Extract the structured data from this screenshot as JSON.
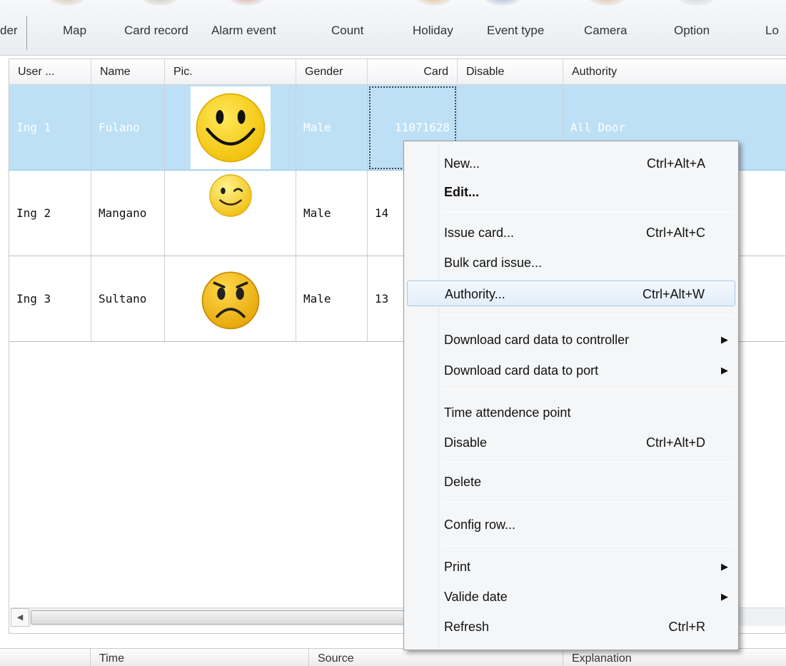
{
  "toolbar": {
    "items": [
      "der",
      "Map",
      "Card record",
      "Alarm event",
      "Count",
      "Holiday",
      "Event type",
      "Camera",
      "Option",
      "Lo"
    ]
  },
  "grid": {
    "columns": [
      "User ...",
      "Name",
      "Pic.",
      "Gender",
      "Card",
      "Disable",
      "Authority"
    ],
    "rows": [
      {
        "user": "Ing 1",
        "name": "Fulano",
        "pic": "smiley-happy",
        "gender": "Male",
        "card": "11071628",
        "disable": "",
        "authority": "All Door"
      },
      {
        "user": "Ing 2",
        "name": "Mangano",
        "pic": "smiley-wink",
        "gender": "Male",
        "card": "14",
        "disable": "",
        "authority": ""
      },
      {
        "user": "Ing 3",
        "name": "Sultano",
        "pic": "smiley-sad",
        "gender": "Male",
        "card": "13",
        "disable": "",
        "authority": ""
      }
    ],
    "selection_color": "#bde0f6"
  },
  "log_header": {
    "columns": [
      "Time",
      "Source",
      "Explanation"
    ]
  },
  "context_menu": {
    "items": [
      {
        "label": "New...",
        "shortcut": "Ctrl+Alt+A"
      },
      {
        "label": "Edit...",
        "shortcut": ""
      },
      {
        "label": "Issue card...",
        "shortcut": "Ctrl+Alt+C"
      },
      {
        "label": "Bulk card issue...",
        "shortcut": ""
      },
      {
        "label": "Authority...",
        "shortcut": "Ctrl+Alt+W",
        "highlighted": true
      },
      {
        "label": "Download card data to controller",
        "shortcut": ""
      },
      {
        "label": "Download card data to port",
        "shortcut": ""
      },
      {
        "label": "Time attendence point",
        "shortcut": ""
      },
      {
        "label": "Disable",
        "shortcut": "Ctrl+Alt+D"
      },
      {
        "label": "Delete",
        "shortcut": ""
      },
      {
        "label": "Config row...",
        "shortcut": ""
      },
      {
        "label": "Print",
        "shortcut": ""
      },
      {
        "label": "Valide date",
        "shortcut": ""
      },
      {
        "label": "Refresh",
        "shortcut": "Ctrl+R"
      }
    ]
  }
}
